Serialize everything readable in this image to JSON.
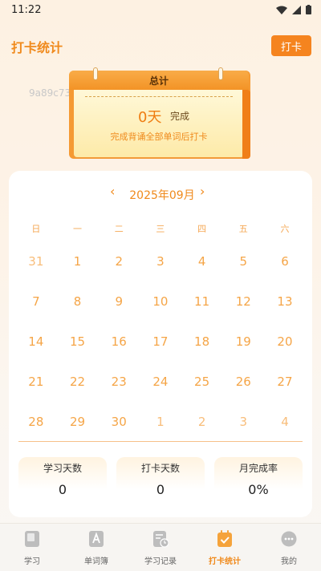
{
  "status_bar": {
    "time": "11:22"
  },
  "header": {
    "title": "打卡统计",
    "checkin_label": "打卡"
  },
  "watermark": "9a89c73e",
  "summary": {
    "band_title": "总计",
    "days_value": "0天",
    "done_label": "完成",
    "hint": "完成背诵全部单词后打卡"
  },
  "calendar": {
    "prev_symbol": "‹",
    "next_symbol": "›",
    "month_label": "2025年09月",
    "weekdays": [
      "日",
      "一",
      "二",
      "三",
      "四",
      "五",
      "六"
    ],
    "weeks": [
      [
        "31",
        "1",
        "2",
        "3",
        "4",
        "5",
        "6"
      ],
      [
        "7",
        "8",
        "9",
        "10",
        "11",
        "12",
        "13"
      ],
      [
        "14",
        "15",
        "16",
        "17",
        "18",
        "19",
        "20"
      ],
      [
        "21",
        "22",
        "23",
        "24",
        "25",
        "26",
        "27"
      ],
      [
        "28",
        "29",
        "30",
        "1",
        "2",
        "3",
        "4"
      ]
    ]
  },
  "stats": [
    {
      "label": "学习天数",
      "value": "0"
    },
    {
      "label": "打卡天数",
      "value": "0"
    },
    {
      "label": "月完成率",
      "value": "0%"
    }
  ],
  "nav": [
    {
      "label": "学习",
      "icon": "book-icon"
    },
    {
      "label": "单词簿",
      "icon": "wordbook-icon"
    },
    {
      "label": "学习记录",
      "icon": "history-icon"
    },
    {
      "label": "打卡统计",
      "icon": "calendar-check-icon"
    },
    {
      "label": "我的",
      "icon": "profile-icon"
    }
  ],
  "colors": {
    "accent": "#f08a1c",
    "button": "#f5841f",
    "day": "#f5a547"
  }
}
